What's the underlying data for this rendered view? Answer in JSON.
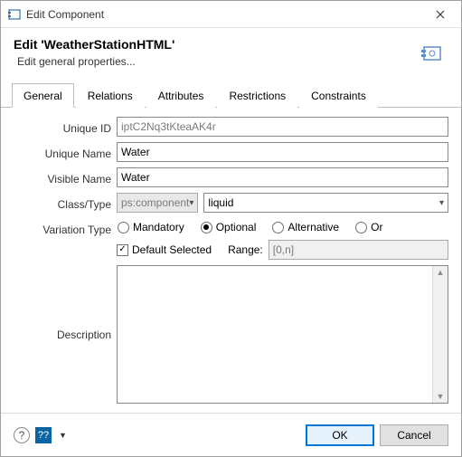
{
  "titlebar": {
    "title": "Edit Component"
  },
  "header": {
    "title": "Edit 'WeatherStationHTML'",
    "subtitle": "Edit general properties..."
  },
  "tabs": {
    "items": [
      {
        "label": "General",
        "active": true
      },
      {
        "label": "Relations"
      },
      {
        "label": "Attributes"
      },
      {
        "label": "Restrictions"
      },
      {
        "label": "Constraints"
      }
    ]
  },
  "form": {
    "uniqueId": {
      "label": "Unique ID",
      "value": "iptC2Nq3tKteaAK4r"
    },
    "uniqueName": {
      "label": "Unique Name",
      "value": "Water"
    },
    "visibleName": {
      "label": "Visible Name",
      "value": "Water"
    },
    "classType": {
      "label": "Class/Type",
      "classValue": "ps:component",
      "typeValue": "liquid"
    },
    "variation": {
      "label": "Variation Type",
      "radios": {
        "mandatory": "Mandatory",
        "optional": "Optional",
        "alternative": "Alternative",
        "or": "Or",
        "selected": "optional"
      },
      "defaultSelected": {
        "label": "Default Selected",
        "checked": true
      },
      "rangeLabel": "Range:",
      "rangeValue": "[0,n]"
    },
    "description": {
      "label": "Description",
      "value": ""
    }
  },
  "footer": {
    "ok": "OK",
    "cancel": "Cancel"
  }
}
